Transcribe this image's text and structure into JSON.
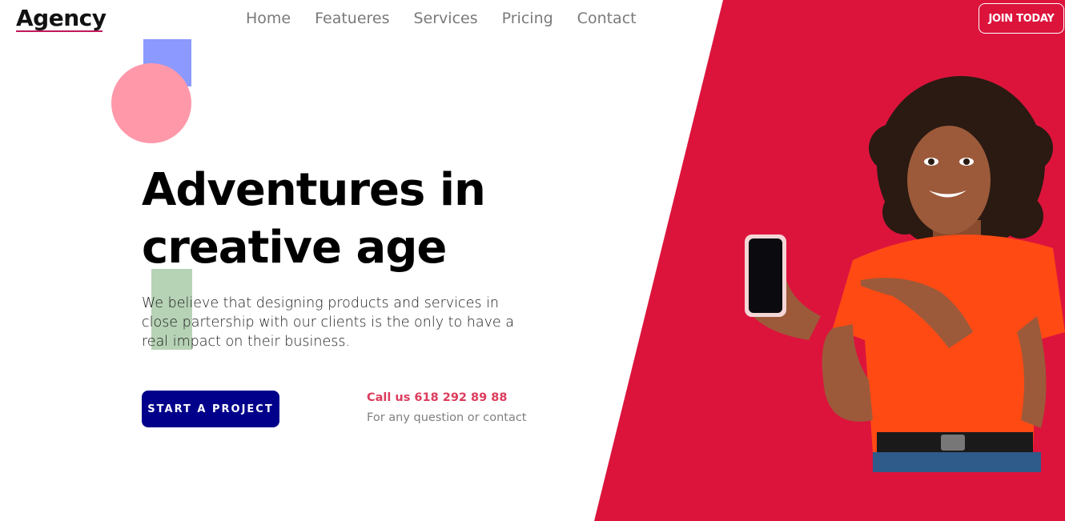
{
  "brand": {
    "logo_text": "Agency",
    "accent": "#dc143c",
    "button_blue": "#00008b"
  },
  "nav": {
    "items": [
      {
        "label": "Home"
      },
      {
        "label": "Featueres"
      },
      {
        "label": "Services"
      },
      {
        "label": "Pricing"
      },
      {
        "label": "Contact"
      }
    ],
    "cta_label": "JOIN TODAY"
  },
  "hero": {
    "headline_line1": "Adventures in",
    "headline_line2": "creative age",
    "description": "We believe that designing products and services in close partership with our clients is the only to have a real impact on their business.",
    "primary_button": "START A PROJECT",
    "call_text": "Call us 618 292 89 88",
    "call_subtext": "For any question or contact",
    "image_icon": "woman-holding-phone-photo"
  }
}
